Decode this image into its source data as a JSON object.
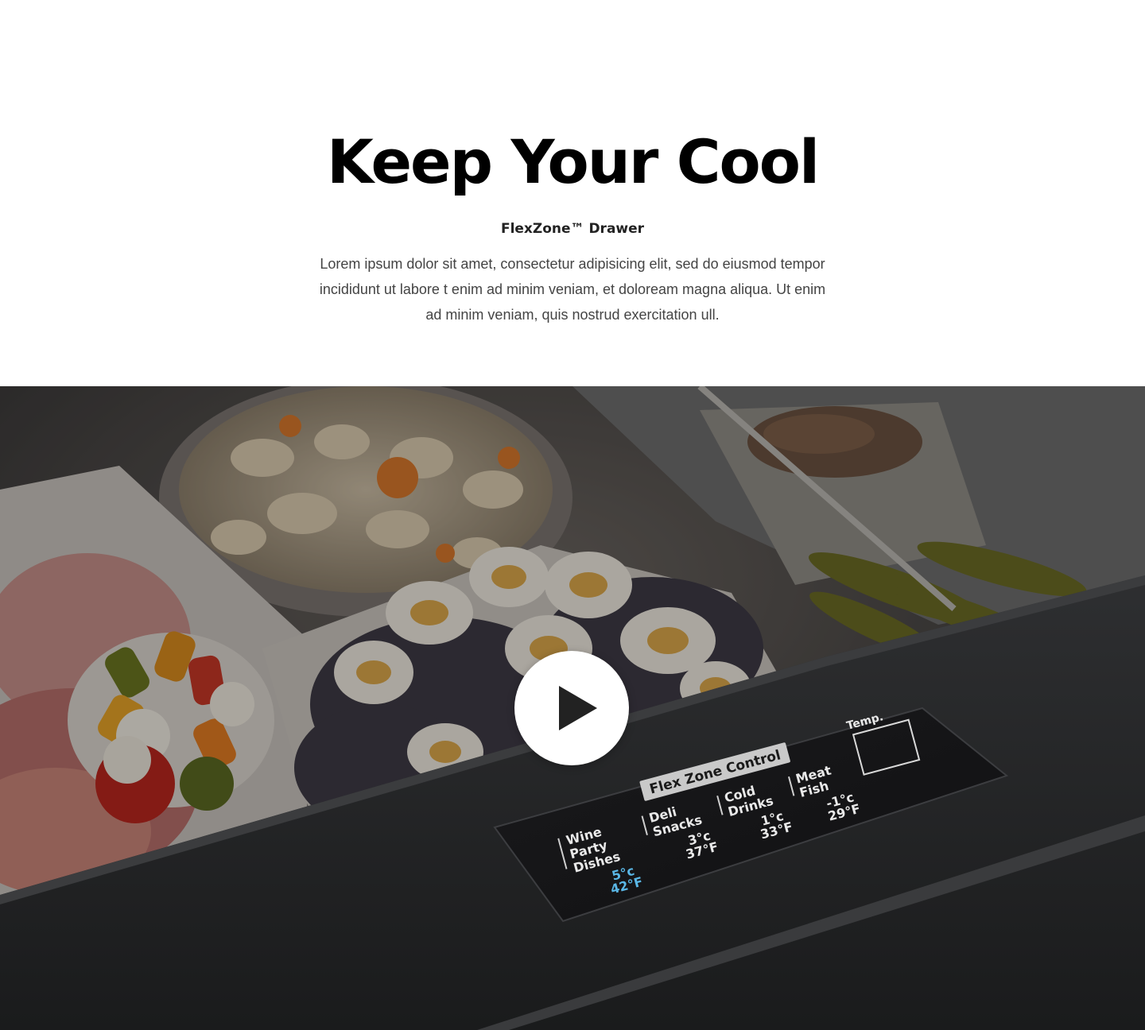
{
  "intro": {
    "headline": "Keep Your Cool",
    "subhead": "FlexZone™ Drawer",
    "description": "Lorem ipsum dolor sit amet, consectetur adipisicing elit, sed do eiusmod tempor incididunt ut labore t enim ad minim veniam, et doloream magna aliqua. Ut enim ad minim veniam, quis nostrud exercitation ull."
  },
  "video": {
    "play_icon": "play-icon",
    "control_panel": {
      "title": "Flex Zone Control",
      "temp_button": "Temp.",
      "modes": [
        {
          "line1": "Wine",
          "line2": "Party",
          "line3": "Dishes",
          "celsius": "5°c",
          "fahrenheit": "42°F",
          "active": true
        },
        {
          "line1": "Deli",
          "line2": "Snacks",
          "line3": "",
          "celsius": "3°c",
          "fahrenheit": "37°F",
          "active": false
        },
        {
          "line1": "Cold",
          "line2": "Drinks",
          "line3": "",
          "celsius": "1°c",
          "fahrenheit": "33°F",
          "active": false
        },
        {
          "line1": "Meat",
          "line2": "Fish",
          "line3": "",
          "celsius": "-1°c",
          "fahrenheit": "29°F",
          "active": false
        }
      ]
    },
    "colors": {
      "active_temp": "#5ab7e6",
      "panel_text": "#e9e9e9"
    }
  }
}
